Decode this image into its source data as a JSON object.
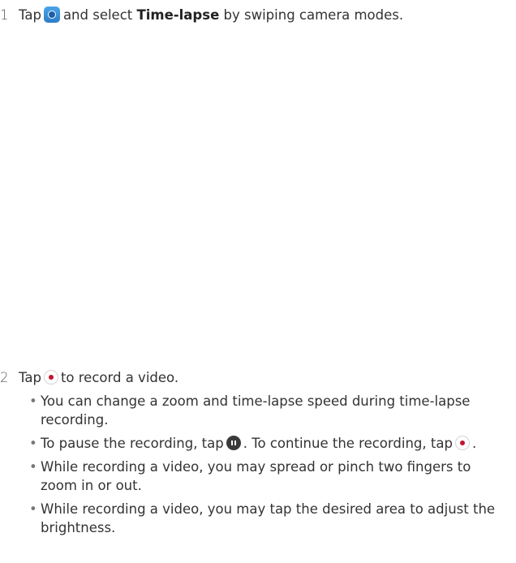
{
  "step1": {
    "number": "1",
    "text_tap": "Tap",
    "icon": "camera-app-icon",
    "text_and_select": "and select",
    "mode_name": "Time-lapse",
    "text_rest": "by swiping camera modes."
  },
  "step2": {
    "number": "2",
    "text_tap": "Tap",
    "icon": "record-icon",
    "text_rest": "to record a video."
  },
  "bullets": {
    "b1": "You can change a zoom and time-lapse speed during time-lapse recording.",
    "b2_part1": "To pause the recording, tap",
    "b2_part2": ". To continue the recording, tap",
    "b2_part3": ".",
    "b3": "While recording a video, you may spread or pinch two fingers to zoom in or out.",
    "b4": "While recording a video, you may tap the desired area to adjust the brightness."
  },
  "colors": {
    "camera_icon": "#3a8fd8",
    "record_dot": "#c4122f",
    "pause_icon": "#3a3a3a"
  }
}
